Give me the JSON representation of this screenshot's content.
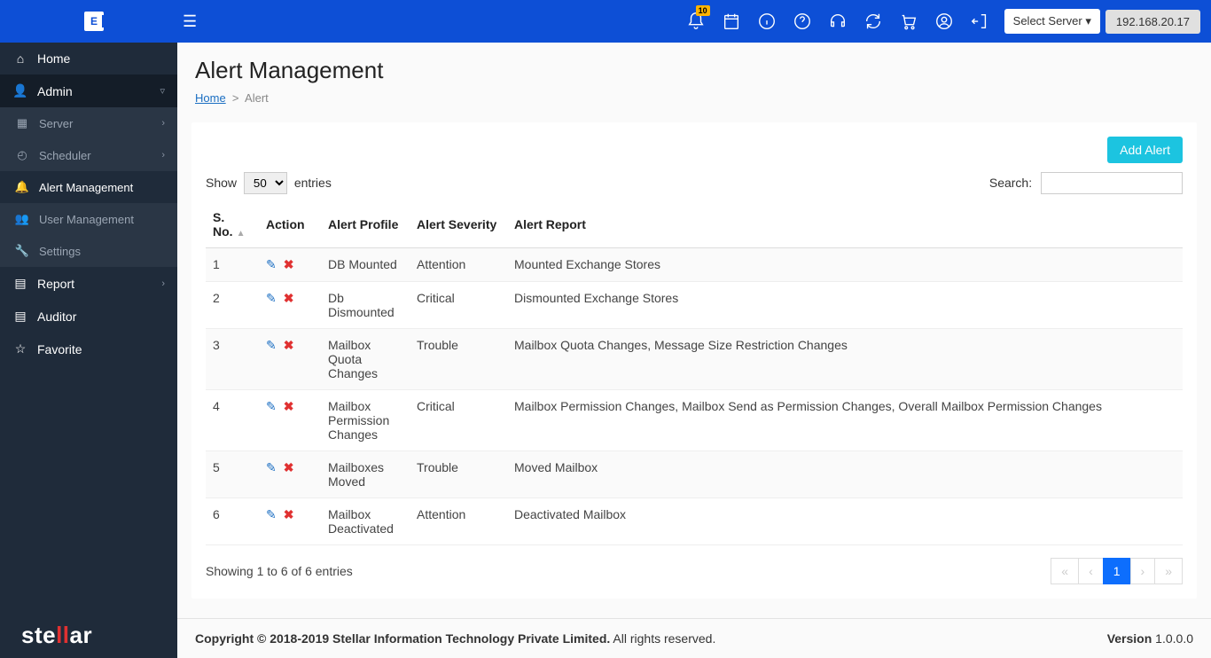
{
  "header": {
    "notification_badge": "10",
    "server_select_label": "Select Server",
    "server_ip": "192.168.20.17"
  },
  "sidebar": {
    "home": "Home",
    "admin": "Admin",
    "server": "Server",
    "scheduler": "Scheduler",
    "alert_mgmt": "Alert Management",
    "user_mgmt": "User Management",
    "settings": "Settings",
    "report": "Report",
    "auditor": "Auditor",
    "favorite": "Favorite"
  },
  "page": {
    "title": "Alert Management",
    "breadcrumb_home": "Home",
    "breadcrumb_sep": ">",
    "breadcrumb_current": "Alert",
    "add_alert": "Add Alert",
    "show_label": "Show",
    "entries_label": "entries",
    "page_size": "50",
    "search_label": "Search:",
    "columns": {
      "sno": "S. No.",
      "action": "Action",
      "profile": "Alert Profile",
      "severity": "Alert Severity",
      "report": "Alert Report"
    },
    "rows": [
      {
        "sno": "1",
        "profile": "DB Mounted",
        "severity": "Attention",
        "report": "Mounted Exchange Stores"
      },
      {
        "sno": "2",
        "profile": "Db Dismounted",
        "severity": "Critical",
        "report": "Dismounted Exchange Stores"
      },
      {
        "sno": "3",
        "profile": "Mailbox Quota Changes",
        "severity": "Trouble",
        "report": "Mailbox Quota Changes, Message Size Restriction Changes"
      },
      {
        "sno": "4",
        "profile": "Mailbox Permission Changes",
        "severity": "Critical",
        "report": "Mailbox Permission Changes, Mailbox Send as Permission Changes, Overall Mailbox Permission Changes"
      },
      {
        "sno": "5",
        "profile": "Mailboxes Moved",
        "severity": "Trouble",
        "report": "Moved Mailbox"
      },
      {
        "sno": "6",
        "profile": "Mailbox Deactivated",
        "severity": "Attention",
        "report": "Deactivated Mailbox"
      }
    ],
    "showing_info": "Showing 1 to 6 of 6 entries",
    "current_page": "1"
  },
  "footer": {
    "copyright_bold": "Copyright © 2018-2019 Stellar Information Technology Private Limited.",
    "copyright_rest": " All rights reserved.",
    "version_label": "Version",
    "version_value": " 1.0.0.0"
  }
}
